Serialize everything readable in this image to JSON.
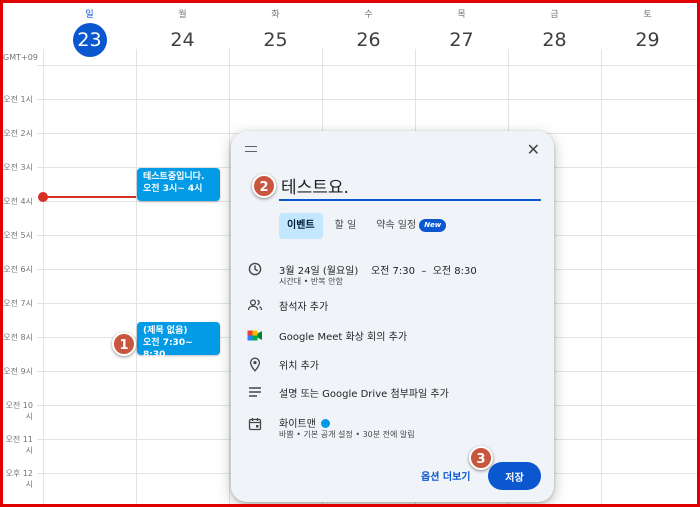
{
  "calendar": {
    "timezone": "GMT+09",
    "days": [
      {
        "dow": "일",
        "date": "23",
        "today": true
      },
      {
        "dow": "월",
        "date": "24"
      },
      {
        "dow": "화",
        "date": "25"
      },
      {
        "dow": "수",
        "date": "26"
      },
      {
        "dow": "목",
        "date": "27"
      },
      {
        "dow": "금",
        "date": "28"
      },
      {
        "dow": "토",
        "date": "29"
      }
    ],
    "hours": [
      "오전 1시",
      "오전 2시",
      "오전 3시",
      "오전 4시",
      "오전 5시",
      "오전 6시",
      "오전 7시",
      "오전 8시",
      "오전 9시",
      "오전 10시",
      "오전 11시",
      "오후 12시"
    ],
    "events": [
      {
        "title": "테스트중입니다.",
        "time": "오전 3시~ 4시"
      },
      {
        "title": "(제목 없음)",
        "time": "오전 7:30~ 8:30"
      }
    ]
  },
  "dialog": {
    "title_value": "테스트요.",
    "tabs": [
      "이벤트",
      "할 일",
      "약속 일정"
    ],
    "new_badge": "New",
    "datetime": "3월 24일 (월요일)    오전 7:30  –  오전 8:30",
    "datetime_sub": "시간대 • 반복 안함",
    "add_guests": "참석자 추가",
    "meet": "Google Meet 화상 회의 추가",
    "location": "위치 추가",
    "description": "설명 또는 Google Drive 첨부파일 추가",
    "calendar_name": "화이트맨",
    "calendar_sub": "바쁨 • 기본 공개 설정 • 30분 전에 알림",
    "more_options": "옵션 더보기",
    "save": "저장"
  },
  "annotations": [
    "1",
    "2",
    "3"
  ],
  "colors": {
    "accent": "#0b57d0",
    "event": "#039be5",
    "now_line": "#d93025",
    "badge": "#c8553d",
    "frame": "#e00000"
  }
}
